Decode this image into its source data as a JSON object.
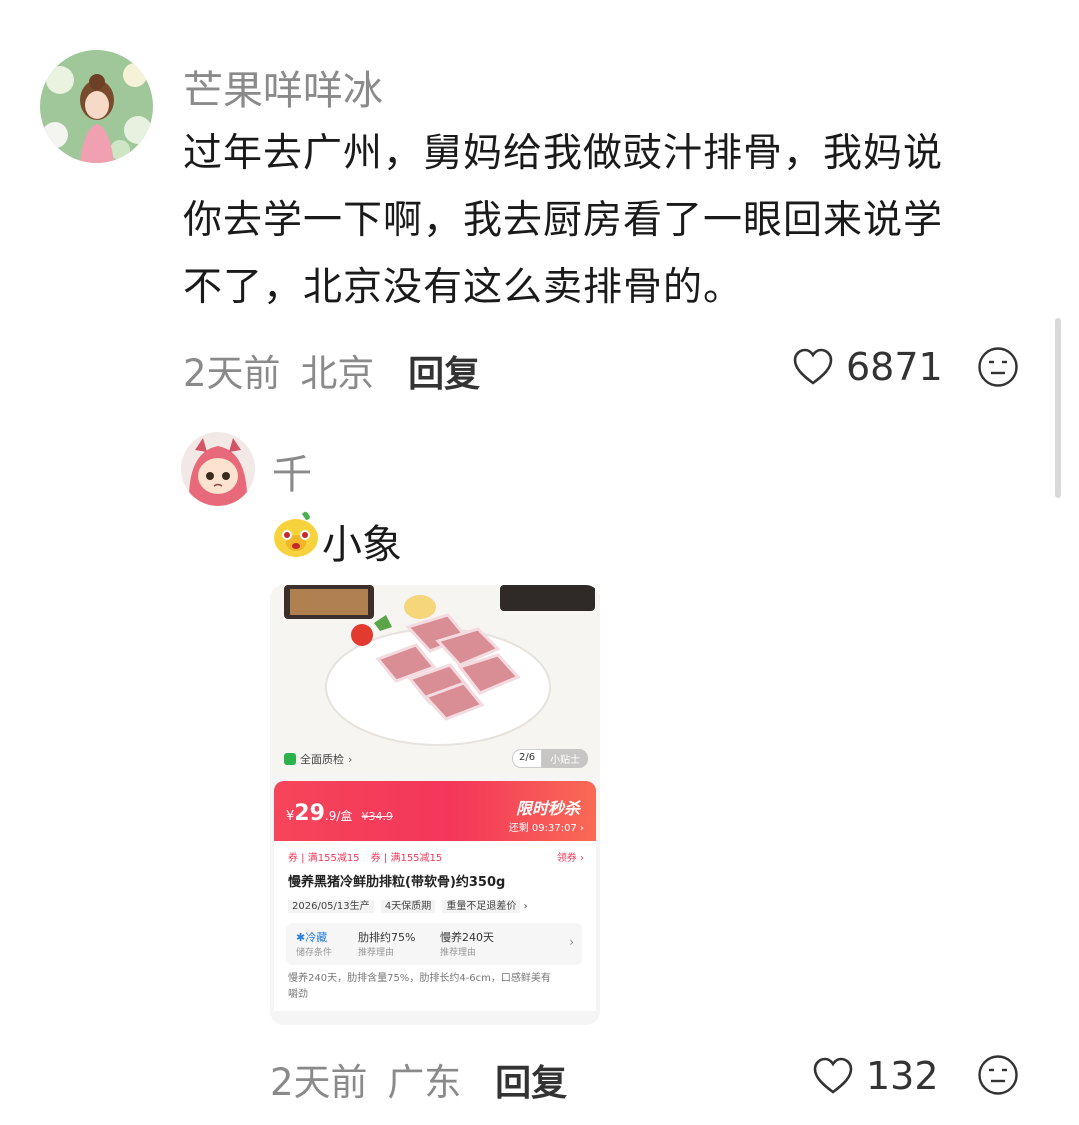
{
  "comment": {
    "username": "芒果咩咩冰",
    "lines": [
      "过年去广州，舅妈给我做豉汁排骨，我妈说",
      "你去学一下啊，我去厨房看了一眼回来说学",
      "不了，北京没有这么卖排骨的。"
    ],
    "time": "2天前",
    "location": "北京",
    "reply_label": "回复",
    "likes": "6871"
  },
  "reply": {
    "username": "千",
    "text": "小象",
    "time": "2天前",
    "location": "广东",
    "reply_label": "回复",
    "likes": "132"
  },
  "product": {
    "quality_check": "全面质检",
    "pager": "2/6",
    "tip": "小贴士",
    "price_symbol": "¥",
    "price_int": "29",
    "price_dec": ".9/盒",
    "price_original": "¥34.9",
    "promo_title": "限时秒杀",
    "countdown": "还剩 09:37:07",
    "coupon1": "券 | 满155减15",
    "coupon2": "券 | 满155减15",
    "coupon_action": "领券",
    "title": "慢养黑猪冷鲜肋排粒(带软骨)约350g",
    "date": "2026/05/13生产",
    "shelf": "4天保质期",
    "weight_note": "重量不足退差价",
    "attr1_title": "冷藏",
    "attr1_sub": "储存条件",
    "attr2_title": "肋排约75%",
    "attr2_sub": "推荐理由",
    "attr3_title": "慢养240天",
    "attr3_sub": "推荐理由",
    "desc_line1": "慢养240天，肋排含量75%，肋排长约4-6cm，口感鲜美有",
    "desc_line2": "嚼劲"
  },
  "colors": {
    "accent_red": "#f4365a",
    "meta_grey": "#8a8a8a"
  },
  "icons": {
    "like": "heart-outline-icon",
    "dislike": "neutral-face-icon",
    "sticker": "little-elephant-sticker"
  }
}
